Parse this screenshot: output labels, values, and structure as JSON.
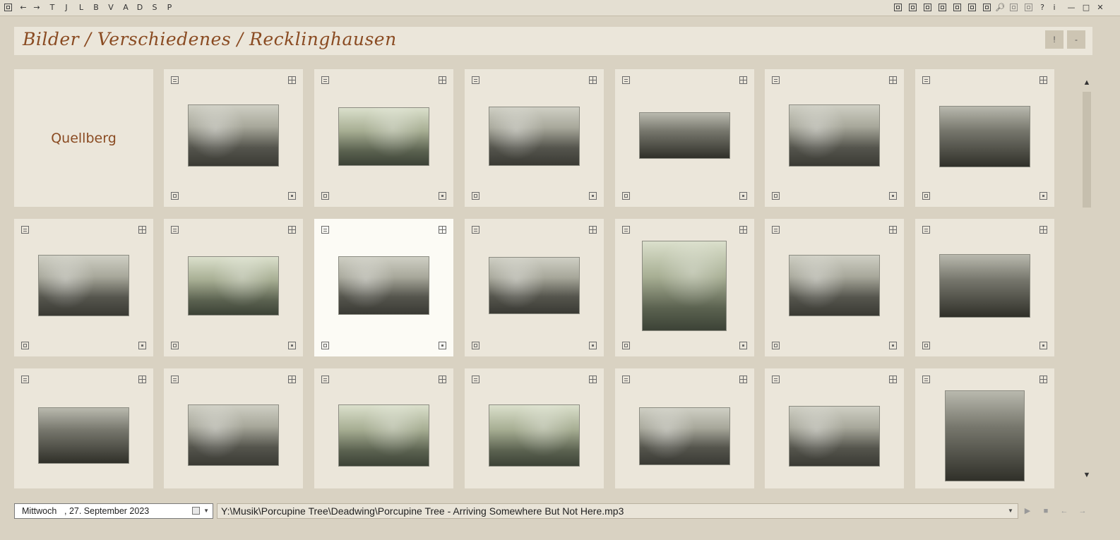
{
  "toolbar": {
    "left_items": [
      "□",
      "←",
      "→",
      "T",
      "J",
      "L",
      "B",
      "V",
      "A",
      "D",
      "S",
      "P"
    ],
    "right_icons": [
      "view-a-icon",
      "view-b-icon",
      "clock-icon",
      "bookmark-icon",
      "grid-icon",
      "layers-icon",
      "stack-icon",
      "search-icon",
      "image-icon",
      "columns-icon",
      "help-icon",
      "info-icon"
    ],
    "help": "?",
    "info": "i",
    "minimize": "—",
    "maximize": "□",
    "close": "✕"
  },
  "header": {
    "title": "Bilder / Verschiedenes / Recklinghausen",
    "btn_exclaim": "!",
    "btn_minus": "-"
  },
  "grid": {
    "folder_label": "Quellberg"
  },
  "statusbar": {
    "day": "Mittwoch",
    "date": ", 27. September 2023",
    "path": "Y:\\Musik\\Porcupine Tree\\Deadwing\\Porcupine Tree - Arriving Somewhere But Not Here.mp3"
  },
  "colors": {
    "background": "#d9d2c2",
    "tile": "#ebe6da",
    "selected_tile": "#fcfbf5",
    "title_accent": "#8a4b22"
  }
}
